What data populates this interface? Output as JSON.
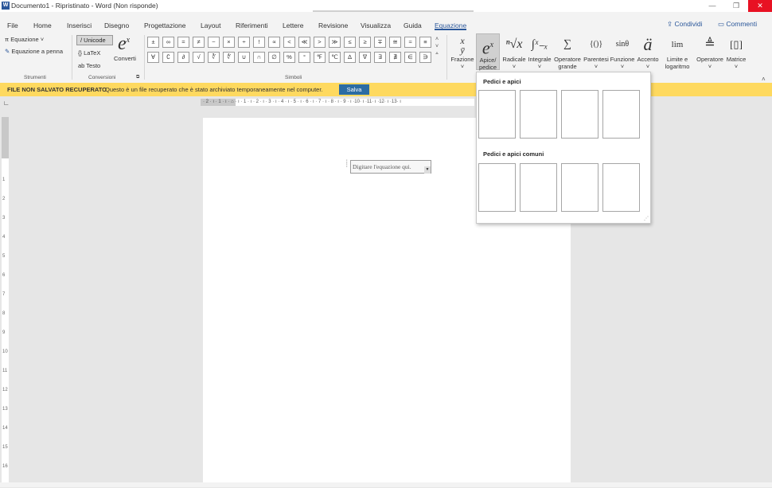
{
  "titlebar": {
    "app_icon": "W",
    "title": "Documento1  -  Ripristinato  -  Word (Non risponde)",
    "minimize_icon": "—",
    "restore_icon": "❐",
    "close_icon": "✕"
  },
  "tabs": [
    {
      "label": "File"
    },
    {
      "label": "Home"
    },
    {
      "label": "Inserisci"
    },
    {
      "label": "Disegno"
    },
    {
      "label": "Progettazione"
    },
    {
      "label": "Layout"
    },
    {
      "label": "Riferimenti"
    },
    {
      "label": "Lettere"
    },
    {
      "label": "Revisione"
    },
    {
      "label": "Visualizza"
    },
    {
      "label": "Guida"
    },
    {
      "label": "Equazione"
    }
  ],
  "header_actions": {
    "share": "Condividi",
    "comments": "Commenti"
  },
  "ribbon": {
    "tools": {
      "equation": "Equazione",
      "ink_equation": "Equazione a penna",
      "group_label": "Strumenti"
    },
    "conversions": {
      "unicode": "Unicode",
      "latex": "LaTeX",
      "text": "Testo",
      "convert": "Converti",
      "group_label": "Conversioni"
    },
    "symbols": {
      "group_label": "Simboli",
      "row1": [
        "±",
        "∞",
        "=",
        "≠",
        "~",
        "×",
        "÷",
        "!",
        "∝",
        "<",
        "≪",
        ">",
        "≫",
        "≤",
        "≥",
        "∓",
        "≅",
        "≈",
        "≡"
      ],
      "row2": [
        "∀",
        "∁",
        "∂",
        "√",
        "∛",
        "∜",
        "∪",
        "∩",
        "∅",
        "%",
        "°",
        "℉",
        "℃",
        "∆",
        "∇",
        "∃",
        "∄",
        "∈",
        "∋"
      ]
    },
    "structures": [
      {
        "label": "Frazione"
      },
      {
        "label": "Apice/\npedice"
      },
      {
        "label": "Radicale"
      },
      {
        "label": "Integrale"
      },
      {
        "label": "Operatore\ngrande"
      },
      {
        "label": "Parentesi"
      },
      {
        "label": "Funzione"
      },
      {
        "label": "Accento"
      },
      {
        "label": "Limite e\nlogaritmo"
      },
      {
        "label": "Operatore"
      },
      {
        "label": "Matrice"
      }
    ],
    "structure_glyphs": {
      "sin": "sinθ",
      "lim": "lim",
      "accent": "ä",
      "parens": "{()}"
    }
  },
  "infobar": {
    "title": "FILE NON SALVATO RECUPERATO",
    "message": "Questo è un file recuperato che è stato archiviato temporaneamente nel computer.",
    "save_button": "Salva"
  },
  "ruler": {
    "text": "· 2 · ı · 1 · ı · ⌂ · ı · 1 · ı · 2 · ı · 3 · ı · 4 · ı · 5 · ı · 6 · ı · 7 · ı · 8 · ı · 9 · ı ·10· ı ·11· ı ·12· ı ·13· ı"
  },
  "document": {
    "equation_placeholder": "Digitare l'equazione qui."
  },
  "dropdown": {
    "section1_title": "Pedici e apici",
    "section2_title": "Pedici e apici comuni"
  },
  "colors": {
    "accent": "#2b579a",
    "infobar": "#fed95f",
    "save_button": "#2b6ca3",
    "close": "#e81123"
  }
}
